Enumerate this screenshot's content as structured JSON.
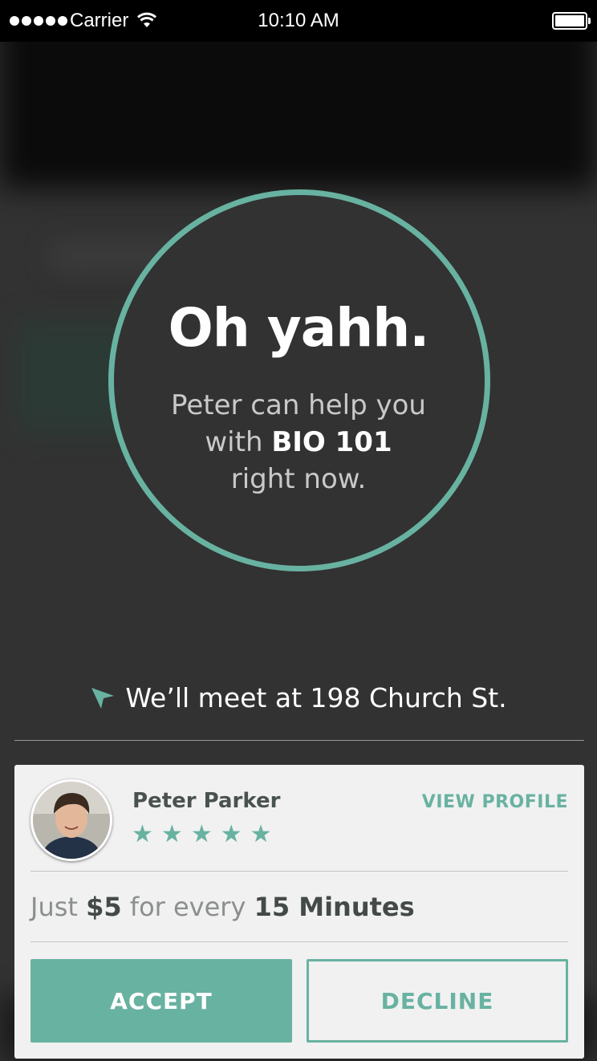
{
  "status_bar": {
    "carrier": "Carrier",
    "time": "10:10 AM"
  },
  "match": {
    "headline": "Oh yahh.",
    "line1": "Peter can help you",
    "line2_prefix": "with",
    "course": "BIO 101",
    "line3": "right now."
  },
  "location": {
    "text": "We’ll meet at 198 Church St."
  },
  "tutor": {
    "name": "Peter Parker",
    "rating": 5,
    "view_profile_label": "VIEW PROFILE"
  },
  "pricing": {
    "prefix": "Just",
    "price": "$5",
    "middle": "for every",
    "duration": "15 Minutes"
  },
  "actions": {
    "accept_label": "ACCEPT",
    "decline_label": "DECLINE"
  },
  "colors": {
    "accent": "#68b2a1",
    "background": "#323232",
    "card": "#f1f1f1"
  },
  "icons": [
    "wifi-icon",
    "battery-icon",
    "location-arrow-icon",
    "star-icon"
  ]
}
